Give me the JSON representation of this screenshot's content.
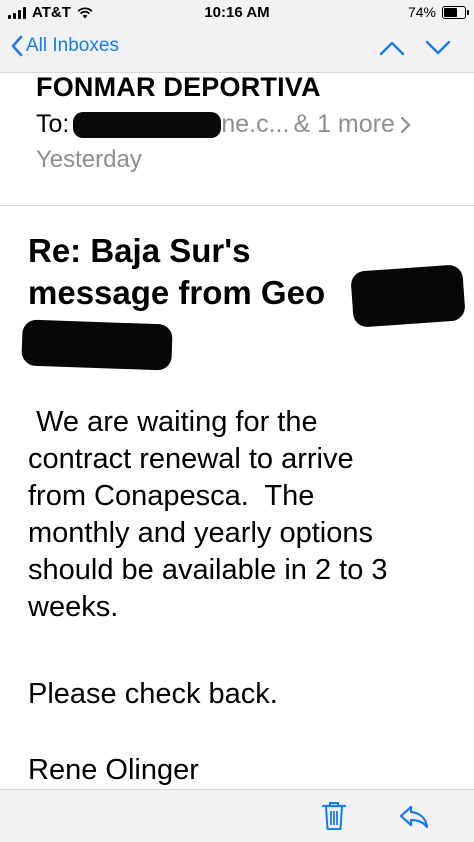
{
  "status_bar": {
    "carrier": "AT&T",
    "time": "10:16 AM",
    "battery_percent": "74%",
    "battery_level": 0.74
  },
  "nav": {
    "back_label": "All Inboxes",
    "icons": [
      "chevron-left-icon",
      "chevron-up-icon",
      "chevron-down-icon"
    ]
  },
  "header": {
    "sender": "FONMAR DEPORTIVA",
    "to_prefix": "To:",
    "to_visible_tail": "ne.c...",
    "to_more": "& 1 more",
    "date": "Yesterday"
  },
  "message": {
    "subject_line1": "Re:  Baja Sur's",
    "subject_line2": "message from Geo",
    "body": " We are waiting for the\ncontract renewal to arrive\nfrom Conapesca.  The\nmonthly and yearly options\nshould be available in 2 to 3\nweeks.",
    "closing": "Please check back.",
    "signature": "Rene Olinger"
  },
  "toolbar": {
    "icons": [
      "trash-icon",
      "reply-icon"
    ]
  },
  "colors": {
    "accent": "#1a7bf0",
    "bar_bg": "#f2f2f4",
    "secondary_text": "#8e8e93"
  }
}
